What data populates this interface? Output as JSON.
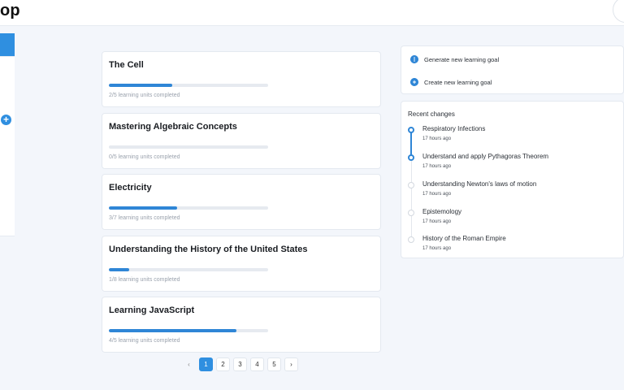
{
  "app": {
    "title_fragment": "op"
  },
  "sidebar": {
    "add_icon": "+"
  },
  "courses": [
    {
      "title": "The Cell",
      "completed": 2,
      "total": 5,
      "progress_text": "2/5 learning units completed"
    },
    {
      "title": "Mastering Algebraic Concepts",
      "completed": 0,
      "total": 5,
      "progress_text": "0/5 learning units completed"
    },
    {
      "title": "Electricity",
      "completed": 3,
      "total": 7,
      "progress_text": "3/7 learning units completed"
    },
    {
      "title": "Understanding the History of the United States",
      "completed": 1,
      "total": 8,
      "progress_text": "1/8 learning units completed"
    },
    {
      "title": "Learning JavaScript",
      "completed": 4,
      "total": 5,
      "progress_text": "4/5 learning units completed"
    }
  ],
  "pagination": {
    "prev": "‹",
    "pages": [
      "1",
      "2",
      "3",
      "4",
      "5"
    ],
    "current": "1",
    "next": "›"
  },
  "actions": {
    "generate_label": "Generate new learning goal",
    "create_label": "Create new learning goal",
    "generate_icon": "brain-icon",
    "create_icon": "plus-circle-icon"
  },
  "recent_changes": {
    "title": "Recent changes",
    "items": [
      {
        "name": "Respiratory Infections",
        "time": "17 hours ago",
        "active": true
      },
      {
        "name": "Understand and apply Pythagoras Theorem",
        "time": "17 hours ago",
        "active": true
      },
      {
        "name": "Understanding Newton's laws of motion",
        "time": "17 hours ago",
        "active": false
      },
      {
        "name": "Epistemology",
        "time": "17 hours ago",
        "active": false
      },
      {
        "name": "History of the Roman Empire",
        "time": "17 hours ago",
        "active": false
      }
    ]
  },
  "colors": {
    "accent": "#2f8fe0",
    "background": "#f3f6fb",
    "card": "#ffffff"
  }
}
